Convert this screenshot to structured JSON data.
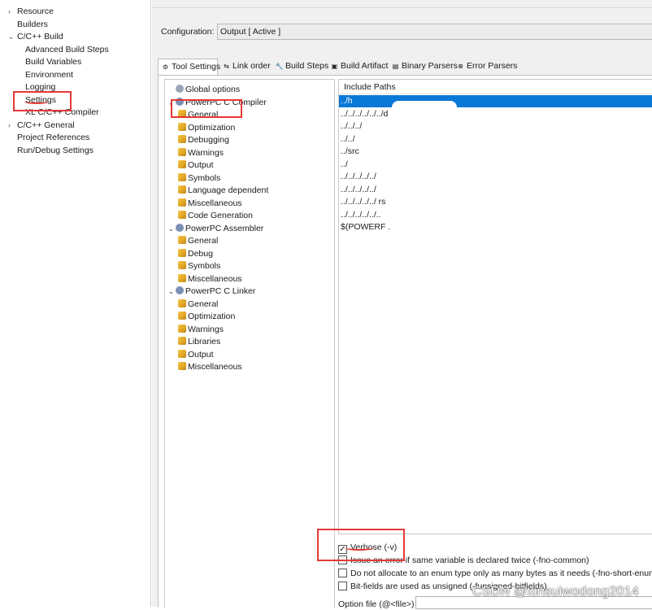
{
  "left_nav": {
    "items": [
      {
        "label": "Resource",
        "level": 0,
        "chevron": "›"
      },
      {
        "label": "Builders",
        "level": 0,
        "chevron": ""
      },
      {
        "label": "C/C++ Build",
        "level": 0,
        "chevron": "⌄"
      },
      {
        "label": "Advanced Build Steps",
        "level": 1,
        "chevron": ""
      },
      {
        "label": "Build Variables",
        "level": 1,
        "chevron": ""
      },
      {
        "label": "Environment",
        "level": 1,
        "chevron": ""
      },
      {
        "label": "Logging",
        "level": 1,
        "chevron": ""
      },
      {
        "label": "Settings",
        "level": 1,
        "chevron": ""
      },
      {
        "label": "XL C/C++ Compiler",
        "level": 1,
        "chevron": ""
      },
      {
        "label": "C/C++ General",
        "level": 0,
        "chevron": "›"
      },
      {
        "label": "Project References",
        "level": 0,
        "chevron": ""
      },
      {
        "label": "Run/Debug Settings",
        "level": 0,
        "chevron": ""
      }
    ]
  },
  "configuration": {
    "label": "Configuration:",
    "value": "Output  [ Active ]"
  },
  "tabs": [
    {
      "label": "Tool Settings",
      "icon": "gear-icon",
      "glyph": "⚙"
    },
    {
      "label": "Link order",
      "icon": "link-icon",
      "glyph": "⇆"
    },
    {
      "label": "Build Steps",
      "icon": "wrench-icon",
      "glyph": "🔧"
    },
    {
      "label": "Build Artifact",
      "icon": "artifact-icon",
      "glyph": "▣"
    },
    {
      "label": "Binary Parsers",
      "icon": "binary-icon",
      "glyph": "▤"
    },
    {
      "label": "Error Parsers",
      "icon": "error-icon",
      "glyph": "⊗"
    }
  ],
  "tool_tree": [
    {
      "label": "Global options",
      "level": 0,
      "toggle": "",
      "icon": "gear-icon"
    },
    {
      "label": "PowerPC C Compiler",
      "level": 0,
      "toggle": "⌄",
      "icon": "tool-icon"
    },
    {
      "label": "General",
      "level": 1,
      "toggle": "",
      "icon": "settings-page-icon"
    },
    {
      "label": "Optimization",
      "level": 1,
      "toggle": "",
      "icon": "settings-page-icon"
    },
    {
      "label": "Debugging",
      "level": 1,
      "toggle": "",
      "icon": "settings-page-icon"
    },
    {
      "label": "Warnings",
      "level": 1,
      "toggle": "",
      "icon": "settings-page-icon"
    },
    {
      "label": "Output",
      "level": 1,
      "toggle": "",
      "icon": "settings-page-icon"
    },
    {
      "label": "Symbols",
      "level": 1,
      "toggle": "",
      "icon": "settings-page-icon"
    },
    {
      "label": "Language dependent",
      "level": 1,
      "toggle": "",
      "icon": "settings-page-icon"
    },
    {
      "label": "Miscellaneous",
      "level": 1,
      "toggle": "",
      "icon": "settings-page-icon"
    },
    {
      "label": "Code Generation",
      "level": 1,
      "toggle": "",
      "icon": "settings-page-icon"
    },
    {
      "label": "PowerPC Assembler",
      "level": 0,
      "toggle": "⌄",
      "icon": "tool-icon"
    },
    {
      "label": "General",
      "level": 1,
      "toggle": "",
      "icon": "settings-page-icon"
    },
    {
      "label": "Debug",
      "level": 1,
      "toggle": "",
      "icon": "settings-page-icon"
    },
    {
      "label": "Symbols",
      "level": 1,
      "toggle": "",
      "icon": "settings-page-icon"
    },
    {
      "label": "Miscellaneous",
      "level": 1,
      "toggle": "",
      "icon": "settings-page-icon"
    },
    {
      "label": "PowerPC C Linker",
      "level": 0,
      "toggle": "⌄",
      "icon": "tool-icon"
    },
    {
      "label": "General",
      "level": 1,
      "toggle": "",
      "icon": "settings-page-icon"
    },
    {
      "label": "Optimization",
      "level": 1,
      "toggle": "",
      "icon": "settings-page-icon"
    },
    {
      "label": "Warnings",
      "level": 1,
      "toggle": "",
      "icon": "settings-page-icon"
    },
    {
      "label": "Libraries",
      "level": 1,
      "toggle": "",
      "icon": "settings-page-icon"
    },
    {
      "label": "Output",
      "level": 1,
      "toggle": "",
      "icon": "settings-page-icon"
    },
    {
      "label": "Miscellaneous",
      "level": 1,
      "toggle": "",
      "icon": "settings-page-icon"
    }
  ],
  "include_paths": {
    "header": "Include Paths",
    "rows": [
      "../h",
      "../../../../../../d",
      "../../../",
      "../../",
      "../src",
      "../",
      "../../../../../",
      "../../../../../",
      "../../../../../     rs",
      "../../../../../..",
      "$(POWERF                                      ."
    ]
  },
  "options": [
    {
      "label": "Verbose (-v)",
      "checked": true
    },
    {
      "label": "Issue an error if same variable is declared twice (-fno-common)",
      "checked": false
    },
    {
      "label": "Do not allocate to an enum type only as many bytes as it needs (-fno-short-enums)",
      "checked": false
    },
    {
      "label": "Bit-fields are used as unsigned (-funsigned-bitfields)",
      "checked": false
    }
  ],
  "option_file": {
    "label": "Option file (@<file>)",
    "value": ""
  },
  "watermark": "CSDN @xinsuiwodong2014",
  "colors": {
    "selection": "#0a78d7",
    "annotation_red": "#e53935"
  }
}
